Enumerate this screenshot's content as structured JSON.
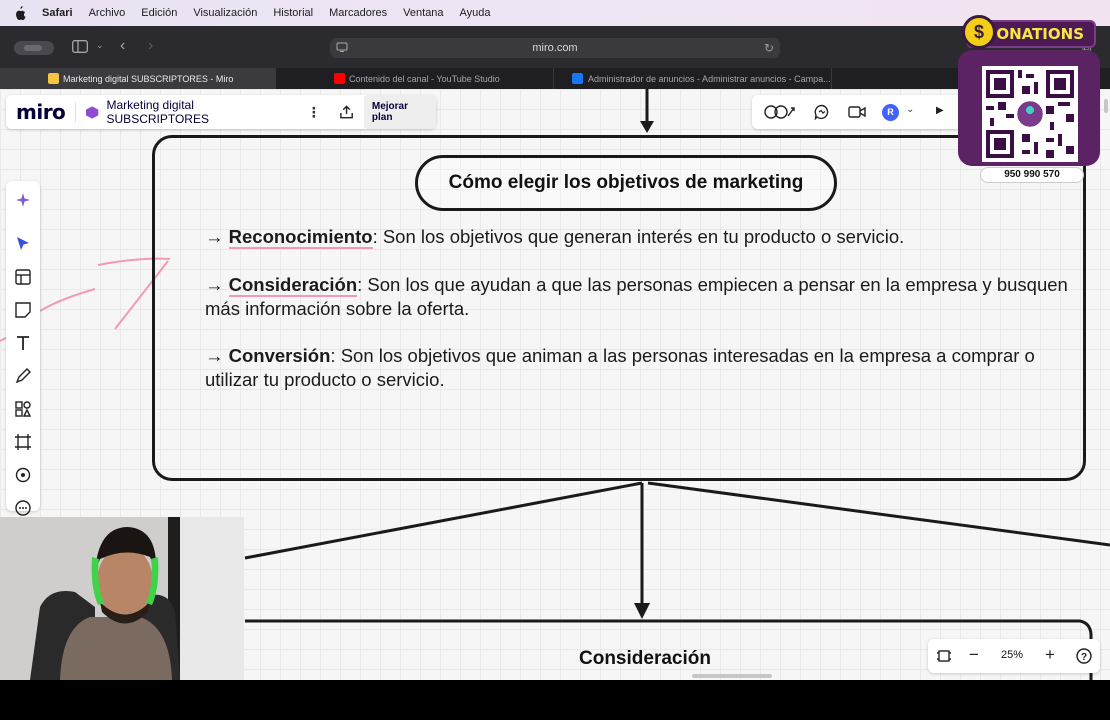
{
  "menubar": {
    "app": "Safari",
    "items": [
      "Archivo",
      "Edición",
      "Visualización",
      "Historial",
      "Marcadores",
      "Ventana",
      "Ayuda"
    ]
  },
  "browser": {
    "url": "miro.com",
    "tabs": [
      {
        "label": "Marketing digital SUBSCRIPTORES - Miro",
        "active": true
      },
      {
        "label": "Contenido del canal - YouTube Studio",
        "active": false
      },
      {
        "label": "Administrador de anuncios - Administrar anuncios - Campa...",
        "active": false
      }
    ]
  },
  "miro": {
    "logo": "miro",
    "board_title": "Marketing digital SUBSCRIPTORES",
    "upgrade_label": "Mejorar plan",
    "avatar_initial": "R",
    "zoom": "25%"
  },
  "board": {
    "frame_title": "Cómo elegir los objetivos de marketing",
    "items": [
      {
        "arrow": "→",
        "term": "Reconocimiento",
        "text": ": Son los objetivos que generan interés en tu producto o servicio."
      },
      {
        "arrow": "→",
        "term": "Consideración",
        "text": ": Son los que ayudan a que las personas empiecen a pensar en la empresa y busquen más información sobre la oferta."
      },
      {
        "arrow": "→",
        "term": "Conversión",
        "text": ": Son los objetivos que animan a las personas interesadas en la empresa a comprar o utilizar tu producto o servicio."
      }
    ],
    "next_frame_title": "Consideración"
  },
  "overlay": {
    "donations_label": "DONATIONS",
    "coin_symbol": "$",
    "phone": "950 990 570"
  },
  "colors": {
    "miro_blue": "#4262ff",
    "donation_purple": "#5b2363",
    "donation_yellow": "#f7e840"
  }
}
